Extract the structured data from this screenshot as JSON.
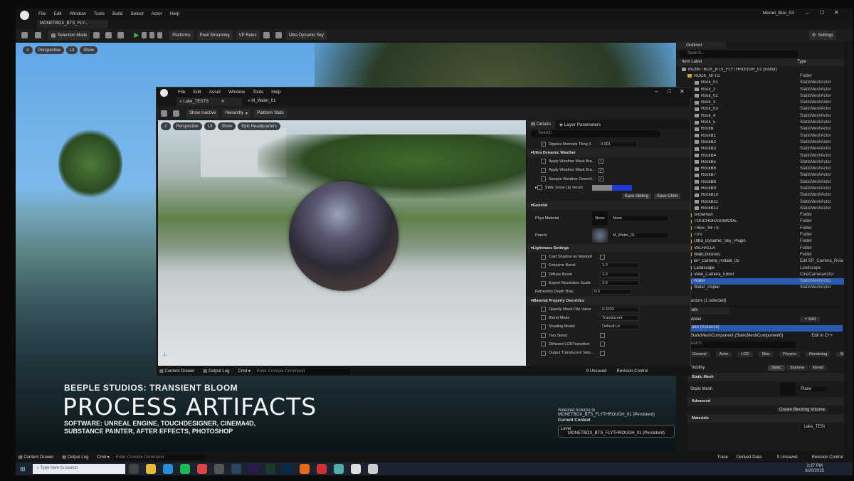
{
  "bg_window": {
    "menu": [
      "File",
      "Edit",
      "Window",
      "Tools",
      "Build",
      "Select",
      "Actor",
      "Help"
    ],
    "tab": "MONETBOX_BTS_FLY...",
    "title": "Monet_Box_03",
    "toolbar": {
      "mode": "Selection Mode",
      "platforms": "Platforms",
      "pixel_streaming": "Pixel Streaming",
      "vp_roles": "VP Roles",
      "sky": "Ultra Dynamic Sky",
      "settings": "Settings"
    },
    "viewport_pills": [
      "Perspective",
      "Lit",
      "Show"
    ]
  },
  "outliner": {
    "title": "Outliner",
    "search": "Search...",
    "col_label": "Item Label",
    "col_type": "Type",
    "rows": [
      [
        "MONETBOX_BTS_FLYTHROUGH_01 (Editor)",
        ""
      ],
      [
        "ROCK_NFTS",
        "Folder"
      ],
      [
        "Rock_01",
        "StaticMeshActor"
      ],
      [
        "Rock_2",
        "StaticMeshActor"
      ],
      [
        "Rock_02",
        "StaticMeshActor"
      ],
      [
        "Rock_3",
        "StaticMeshActor"
      ],
      [
        "Rock_03",
        "StaticMeshActor"
      ],
      [
        "Rock_4",
        "StaticMeshActor"
      ],
      [
        "Rock_5",
        "StaticMeshActor"
      ],
      [
        "RockB",
        "StaticMeshActor"
      ],
      [
        "RockB1",
        "StaticMeshActor"
      ],
      [
        "RockB2",
        "StaticMeshActor"
      ],
      [
        "RockB3",
        "StaticMeshActor"
      ],
      [
        "RockB4",
        "StaticMeshActor"
      ],
      [
        "RockB5",
        "StaticMeshActor"
      ],
      [
        "RockB6",
        "StaticMeshActor"
      ],
      [
        "RockB7",
        "StaticMeshActor"
      ],
      [
        "RockB8",
        "StaticMeshActor"
      ],
      [
        "RockB9",
        "StaticMeshActor"
      ],
      [
        "RockB10",
        "StaticMeshActor"
      ],
      [
        "RockB11",
        "StaticMeshActor"
      ],
      [
        "RockB12",
        "StaticMeshActor"
      ],
      [
        "Snowman",
        "Folder"
      ],
      [
        "TOUCHGRASSMODE",
        "Folder"
      ],
      [
        "TREE_NFTS",
        "Folder"
      ],
      [
        "TVS",
        "Folder"
      ],
      [
        "Ultra_Dynamic_Sky_Plugin",
        "Folder"
      ],
      [
        "VALHALLA",
        "Folder"
      ],
      [
        "WallCollisions",
        "Folder"
      ],
      [
        "BP_Camera_Rotate_05",
        "Edit BP_Camera_Rota"
      ],
      [
        "Landscape",
        "Landscape"
      ],
      [
        "View_Camera_Editor",
        "CineCameraActor"
      ],
      [
        "Water",
        "StaticMeshActor"
      ],
      [
        "Water_Poplar",
        "StaticMeshActor"
      ]
    ],
    "selected_index": 32,
    "count": "1 actors (1 selected)"
  },
  "details_bg": {
    "tab": "tails",
    "name": "Water",
    "add": "+ Add",
    "instance": "ater (Instance)",
    "component": "StaticMeshComponent (StaticMeshComponent0)",
    "edit_cpp": "Edit in C++",
    "search": "earch",
    "filters": [
      "General",
      "Actor",
      "LOD",
      "Misc",
      "Physics",
      "Rendering",
      "Streaming"
    ],
    "mobility": "Mobility",
    "mob_opts": [
      "Static",
      "Stationa",
      "Movat"
    ],
    "static_mesh_sec": "Static Mesh",
    "static_mesh": "Static Mesh",
    "mesh_val": "Plane",
    "advanced": "Advanced",
    "create_blocking": "Create Blocking Volume",
    "materials": "Materials",
    "mat_val": "Lake_TESt"
  },
  "fg_window": {
    "menu": [
      "File",
      "Edit",
      "Asset",
      "Window",
      "Tools",
      "Help"
    ],
    "tabs": [
      "Lake_TESTS",
      "M_Water_01"
    ],
    "toolbar": [
      "Show Inactive",
      "Hierarchy",
      "Platform Stats"
    ],
    "viewport_pills": [
      "Perspective",
      "Lit",
      "Show",
      "Epic Headquarters"
    ],
    "details_tab": "Details",
    "layer_tab": "Layer Parameters",
    "search": "Search",
    "ripple": {
      "label": "Ripples Normals Tiling X",
      "value": "0.001"
    },
    "udw_section": "Ultra Dynamic Weather",
    "udw_rows": [
      "Apply Weather Mask Bra...",
      "Apply Weather Mask Bra...",
      "Sample Weather Overrid..."
    ],
    "swe_label": "SWE Snow Up Vector",
    "save_sibling": "Save Sibling",
    "save_child": "Save Child",
    "general": "General",
    "phys_label": "Phys Material",
    "phys_thumb": "None",
    "phys_val": "None",
    "parent_label": "Parent",
    "parent_val": "M_Water_01",
    "lightmass": "Lightmass Settings",
    "lm_rows": [
      [
        "Cast Shadow as Masked",
        ""
      ],
      [
        "Emissive Boost",
        "1.0"
      ],
      [
        "Diffuse Boost",
        "1.0"
      ],
      [
        "Export Resolution Scale",
        "1.0"
      ]
    ],
    "refraction": {
      "label": "Refraction Depth Bias",
      "value": "0.0"
    },
    "mpo": "Material Property Overrides",
    "mpo_rows": [
      [
        "Opacity Mask Clip Value",
        "0.3333"
      ],
      [
        "Blend Mode",
        "Translucent"
      ],
      [
        "Shading Model",
        "Default Lit"
      ],
      [
        "Two Sided",
        ""
      ],
      [
        "Dithered LODTransition",
        ""
      ],
      [
        "Output Translucent Velo...",
        ""
      ]
    ],
    "bottom": {
      "content_drawer": "Content Drawer",
      "output_log": "Output Log",
      "cmd": "Cmd",
      "console": "Enter Console Command",
      "unsaved": "9 Unsaved",
      "revision": "Revision Control"
    }
  },
  "overlay": {
    "studio": "BEEPLE STUDIOS: TRANSIENT BLOOM",
    "title": "PROCESS ARTIFACTS",
    "software1": "SOFTWARE: UNREAL ENGINE, TOUCHDESIGNER, CINEMA4D,",
    "software2": "SUBSTANCE PAINTER, AFTER EFFECTS, PHOTOSHOP"
  },
  "level_panel": {
    "sel1": "Selected Actor(s) in",
    "sel2": "MONETBOX_BTS_FLYTHROUGH_01 (Persistent)",
    "context": "Current Context",
    "level_label": "Level",
    "level_val": "MONETBOX_BTS_FLYTHROUGH_01 (Persistent)"
  },
  "bg_bottom": {
    "content_drawer": "Content Drawer",
    "output_log": "Output Log",
    "cmd": "Cmd",
    "console": "Enter Console Command",
    "trace": "Trace",
    "derived": "Derived Data",
    "unsaved": "9 Unsaved",
    "revision": "Revision Control"
  },
  "taskbar": {
    "search": "Type here to search",
    "time": "2:37 PM",
    "date": "8/20/2025"
  },
  "colors": {
    "accent_blue": "#1f6fd6",
    "selection": "#2a5bb0",
    "play_green": "#3bb54a"
  }
}
